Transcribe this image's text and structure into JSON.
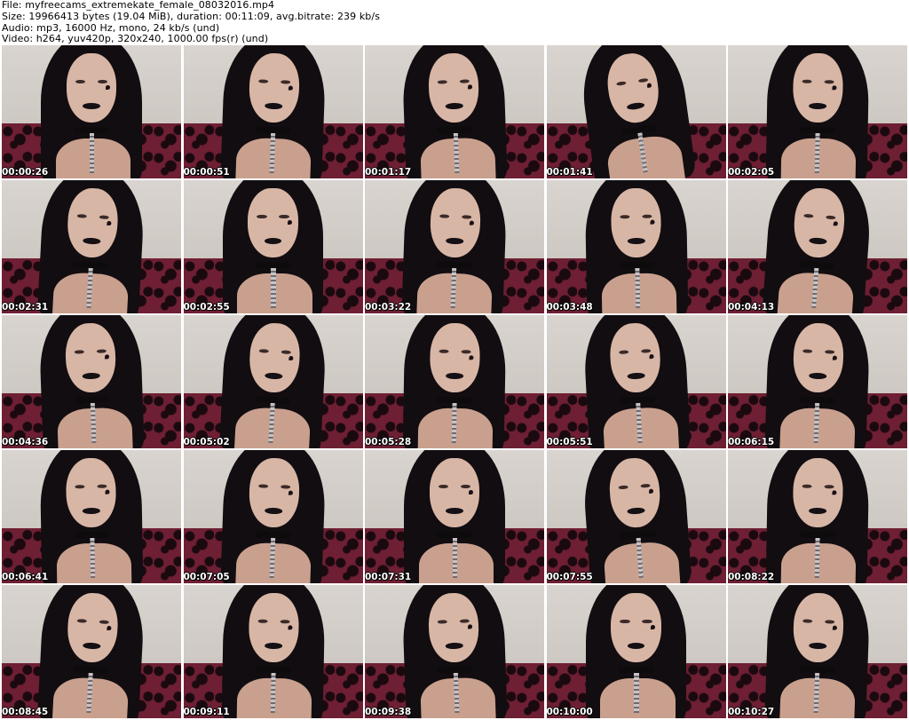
{
  "header": {
    "file_line": "File: myfreecams_extremekate_female_08032016.mp4",
    "size_line": "Size: 19966413 bytes (19.04 MiB), duration: 00:11:09, avg.bitrate: 239 kb/s",
    "audio_line": "Audio: mp3, 16000 Hz, mono, 24 kb/s (und)",
    "video_line": "Video: h264, yuv420p, 320x240, 1000.00 fps(r) (und)"
  },
  "thumbnails": [
    {
      "timestamp": "00:00:26"
    },
    {
      "timestamp": "00:00:51"
    },
    {
      "timestamp": "00:01:17"
    },
    {
      "timestamp": "00:01:41"
    },
    {
      "timestamp": "00:02:05"
    },
    {
      "timestamp": "00:02:31"
    },
    {
      "timestamp": "00:02:55"
    },
    {
      "timestamp": "00:03:22"
    },
    {
      "timestamp": "00:03:48"
    },
    {
      "timestamp": "00:04:13"
    },
    {
      "timestamp": "00:04:36"
    },
    {
      "timestamp": "00:05:02"
    },
    {
      "timestamp": "00:05:28"
    },
    {
      "timestamp": "00:05:51"
    },
    {
      "timestamp": "00:06:15"
    },
    {
      "timestamp": "00:06:41"
    },
    {
      "timestamp": "00:07:05"
    },
    {
      "timestamp": "00:07:31"
    },
    {
      "timestamp": "00:07:55"
    },
    {
      "timestamp": "00:08:22"
    },
    {
      "timestamp": "00:08:45"
    },
    {
      "timestamp": "00:09:11"
    },
    {
      "timestamp": "00:09:38"
    },
    {
      "timestamp": "00:10:00"
    },
    {
      "timestamp": "00:10:27"
    }
  ]
}
